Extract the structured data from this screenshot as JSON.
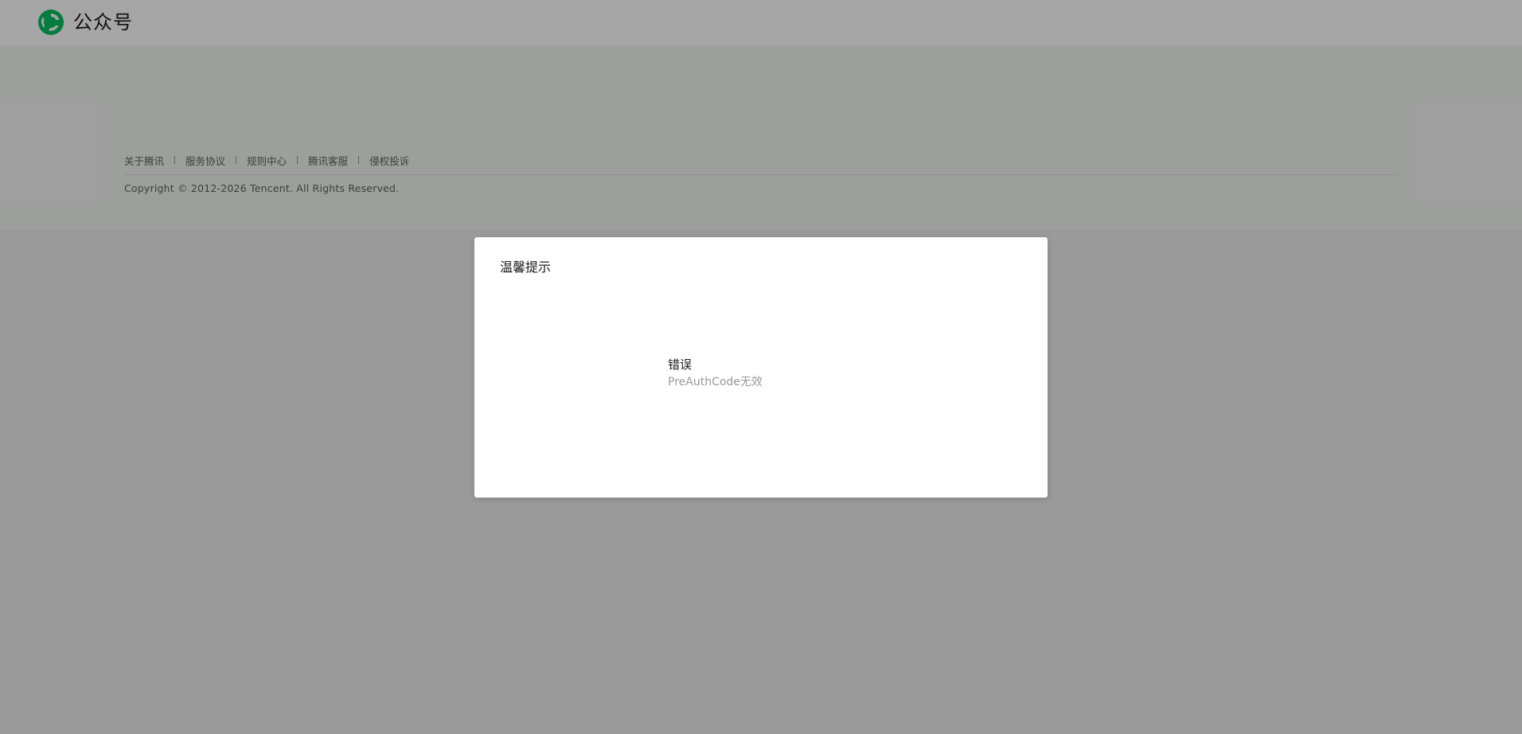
{
  "header": {
    "brand": "公众号",
    "logo_icon": "wechat-official-accounts-logo-icon",
    "brand_color": "#07c160"
  },
  "footer": {
    "links": [
      "关于腾讯",
      "服务协议",
      "规则中心",
      "腾讯客服",
      "侵权投诉"
    ],
    "copyright": "Copyright © 2012-2026 Tencent. All Rights Reserved."
  },
  "dialog": {
    "title": "温馨提示",
    "message_title": "错误",
    "message_detail": "PreAuthCode无效"
  }
}
